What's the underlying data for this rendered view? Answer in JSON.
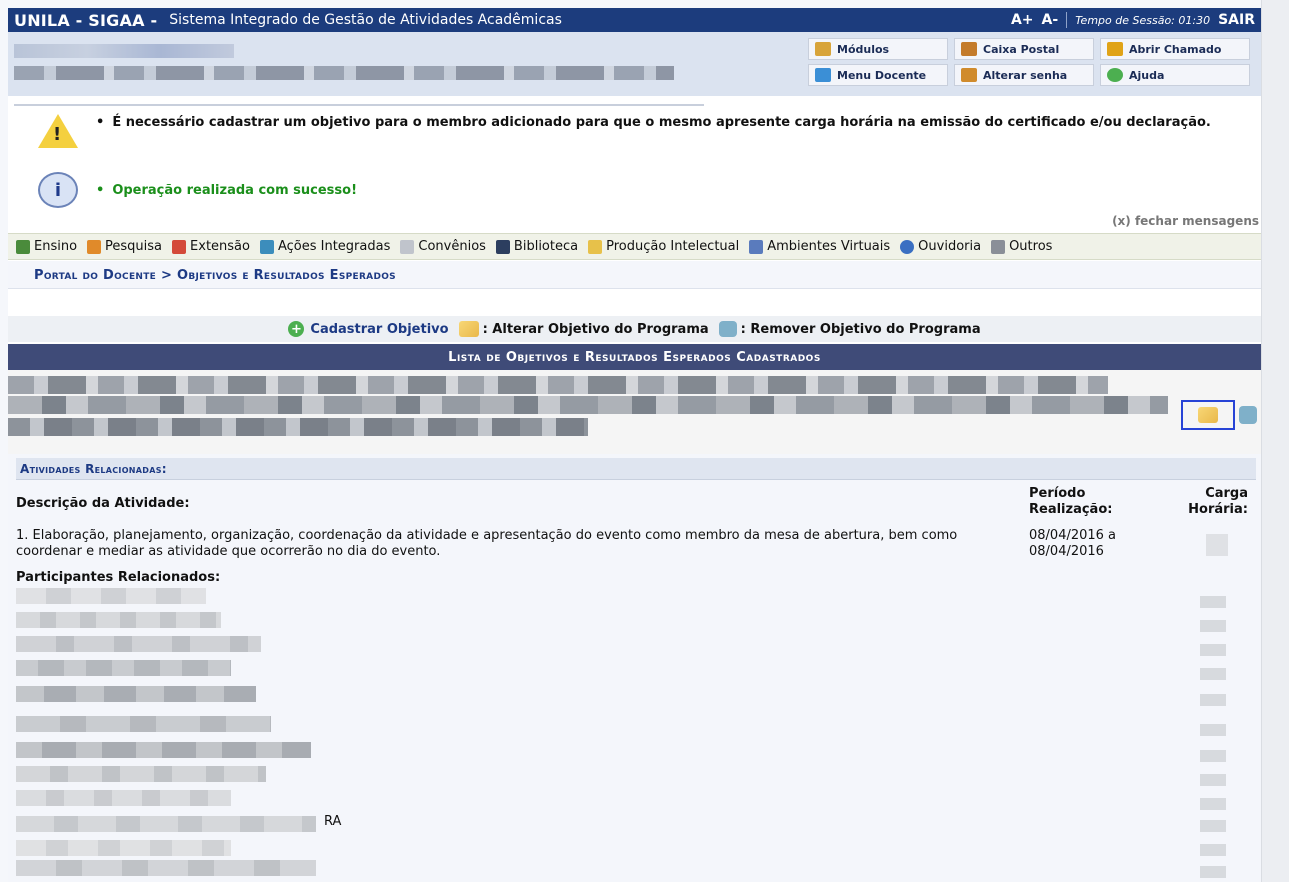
{
  "header": {
    "brand": "UNILA - SIGAA -",
    "system_name": "Sistema Integrado de Gestão de Atividades Acadêmicas",
    "font_increase": "A+",
    "font_decrease": "A-",
    "session_label": "Tempo de Sessão: 01:30",
    "exit_label": "SAIR"
  },
  "modules": [
    {
      "label": "Módulos",
      "icon": "modules-icon",
      "color": "#d8a43a"
    },
    {
      "label": "Caixa Postal",
      "icon": "mailbox-icon",
      "color": "#c47b2a"
    },
    {
      "label": "Abrir Chamado",
      "icon": "ticket-icon",
      "color": "#e0a317"
    },
    {
      "label": "Menu Docente",
      "icon": "teacher-menu-icon",
      "color": "#3b8fd6"
    },
    {
      "label": "Alterar senha",
      "icon": "user-key-icon",
      "color": "#d08b2c"
    },
    {
      "label": "Ajuda",
      "icon": "help-icon",
      "color": "#4caf50"
    }
  ],
  "messages": {
    "warning": "É necessário cadastrar um objetivo para o membro adicionado para que o mesmo apresente carga horária na emissão do certificado e/ou declaração.",
    "success": "Operação realizada com sucesso!",
    "close_label": "(x) fechar mensagens"
  },
  "menu": [
    {
      "label": "Ensino",
      "icon": "books-icon",
      "color": "#4a8b3b"
    },
    {
      "label": "Pesquisa",
      "icon": "flask-icon",
      "color": "#e08a2a"
    },
    {
      "label": "Extensão",
      "icon": "heart-icon",
      "color": "#d44a3a"
    },
    {
      "label": "Ações Integradas",
      "icon": "puzzle-icon",
      "color": "#3c8dbc"
    },
    {
      "label": "Convênios",
      "icon": "document-icon",
      "color": "#c0c4cc"
    },
    {
      "label": "Biblioteca",
      "icon": "library-icon",
      "color": "#2c3e5f"
    },
    {
      "label": "Produção Intelectual",
      "icon": "notebook-icon",
      "color": "#e7c14a"
    },
    {
      "label": "Ambientes Virtuais",
      "icon": "virtual-env-icon",
      "color": "#5a7bbd"
    },
    {
      "label": "Ouvidoria",
      "icon": "ombudsman-icon",
      "color": "#3a6fc2"
    },
    {
      "label": "Outros",
      "icon": "other-icon",
      "color": "#8a8f98"
    }
  ],
  "breadcrumb": "Portal do Docente > Objetivos e Resultados Esperados",
  "legend": {
    "add": "Cadastrar Objetivo",
    "edit": ": Alterar Objetivo do Programa",
    "remove": ": Remover Objetivo do Programa"
  },
  "list_title": "Lista de Objetivos e Resultados Esperados Cadastrados",
  "activities": {
    "section_title": "Atividades Relacionadas:",
    "col_description": "Descrição da Atividade:",
    "col_period": "Período Realização:",
    "col_hours": "Carga Horária:",
    "description": "1. Elaboração, planejamento, organização, coordenação da atividade e apresentação do evento como membro da mesa de abertura, bem como coordenar e mediar as atividade que ocorrerão no dia do evento.",
    "period": "08/04/2016  a 08/04/2016",
    "participants_title": "Participantes Relacionados:",
    "participant_suffix": "RA"
  },
  "colors": {
    "topbar": "#1c3c7d",
    "list_header": "#3f4b78",
    "link_blue": "#1d3a84",
    "success_green": "#1b8f1b",
    "highlight_border": "#2743d6"
  }
}
